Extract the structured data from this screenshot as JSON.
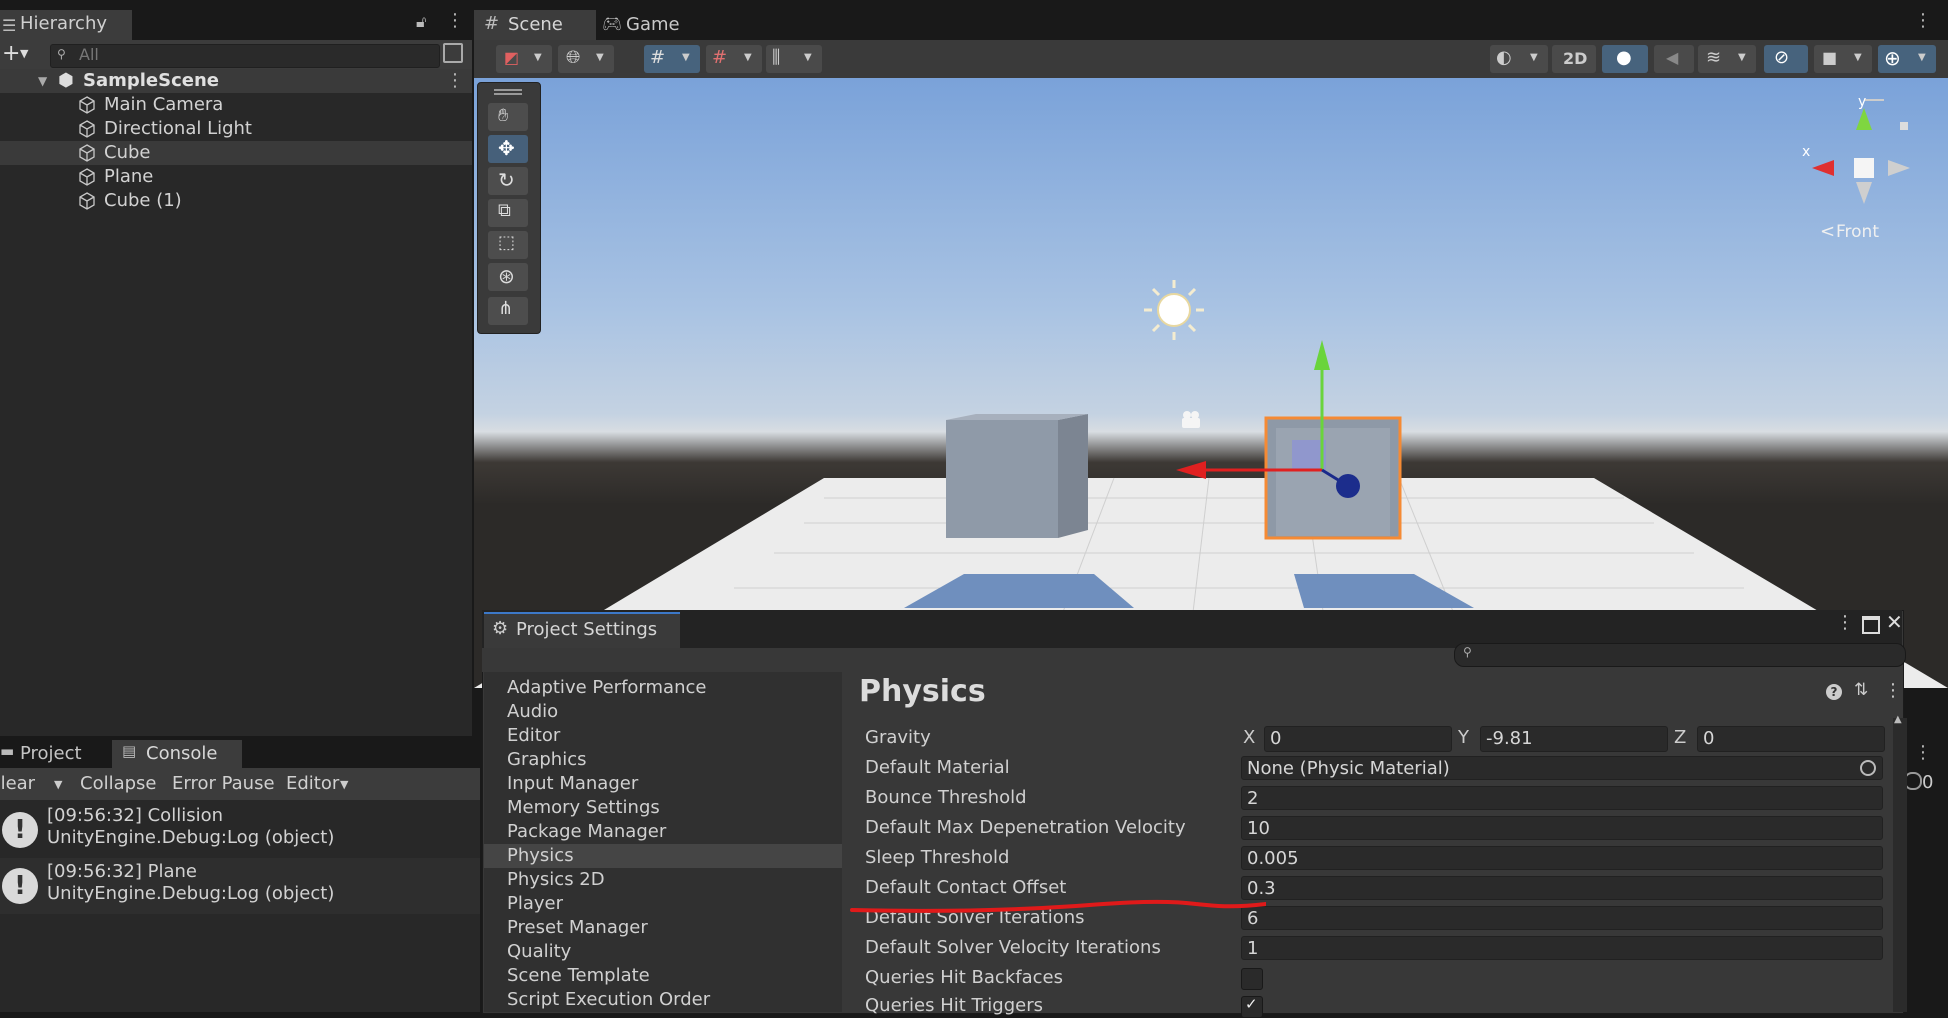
{
  "hierarchy": {
    "tab_label": "Hierarchy",
    "search_placeholder": "All",
    "scene_name": "SampleScene",
    "items": [
      "Main Camera",
      "Directional Light",
      "Cube",
      "Plane",
      "Cube (1)"
    ],
    "selected_item": "Cube"
  },
  "scene": {
    "tabs": [
      "Scene",
      "Game"
    ],
    "toolbar": {
      "two_d_label": "2D"
    },
    "gizmo": {
      "y_label": "y",
      "x_label": "x",
      "view_label": "Front"
    }
  },
  "console": {
    "tabs": [
      "Project",
      "Console"
    ],
    "toolbar": {
      "clear": "Clear",
      "collapse": "Collapse",
      "error_pause": "Error Pause",
      "editor": "Editor"
    },
    "count": "0",
    "logs": [
      {
        "line1": "[09:56:32] Collision",
        "line2": "UnityEngine.Debug:Log (object)"
      },
      {
        "line1": "[09:56:32] Plane",
        "line2": "UnityEngine.Debug:Log (object)"
      }
    ]
  },
  "project_settings": {
    "title": "Project Settings",
    "nav": [
      "Adaptive Performance",
      "Audio",
      "Editor",
      "Graphics",
      "Input Manager",
      "Memory Settings",
      "Package Manager",
      "Physics",
      "Physics 2D",
      "Player",
      "Preset Manager",
      "Quality",
      "Scene Template",
      "Script Execution Order"
    ],
    "selected_nav": "Physics",
    "heading": "Physics",
    "gravity": {
      "label": "Gravity",
      "x_label": "X",
      "x": "0",
      "y_label": "Y",
      "y": "-9.81",
      "z_label": "Z",
      "z": "0"
    },
    "rows": [
      {
        "label": "Default Material",
        "value": "None (Physic Material)"
      },
      {
        "label": "Bounce Threshold",
        "value": "2"
      },
      {
        "label": "Default Max Depenetration Velocity",
        "value": "10"
      },
      {
        "label": "Sleep Threshold",
        "value": "0.005"
      },
      {
        "label": "Default Contact Offset",
        "value": "0.3"
      },
      {
        "label": "Default Solver Iterations",
        "value": "6"
      },
      {
        "label": "Default Solver Velocity Iterations",
        "value": "1"
      }
    ],
    "checks": [
      {
        "label": "Queries Hit Backfaces",
        "checked": false
      },
      {
        "label": "Queries Hit Triggers",
        "checked": true
      }
    ]
  },
  "colors": {
    "accent_selection": "#46607a",
    "annotation_red": "#e01a1a",
    "selected_outline": "#f58a34"
  }
}
